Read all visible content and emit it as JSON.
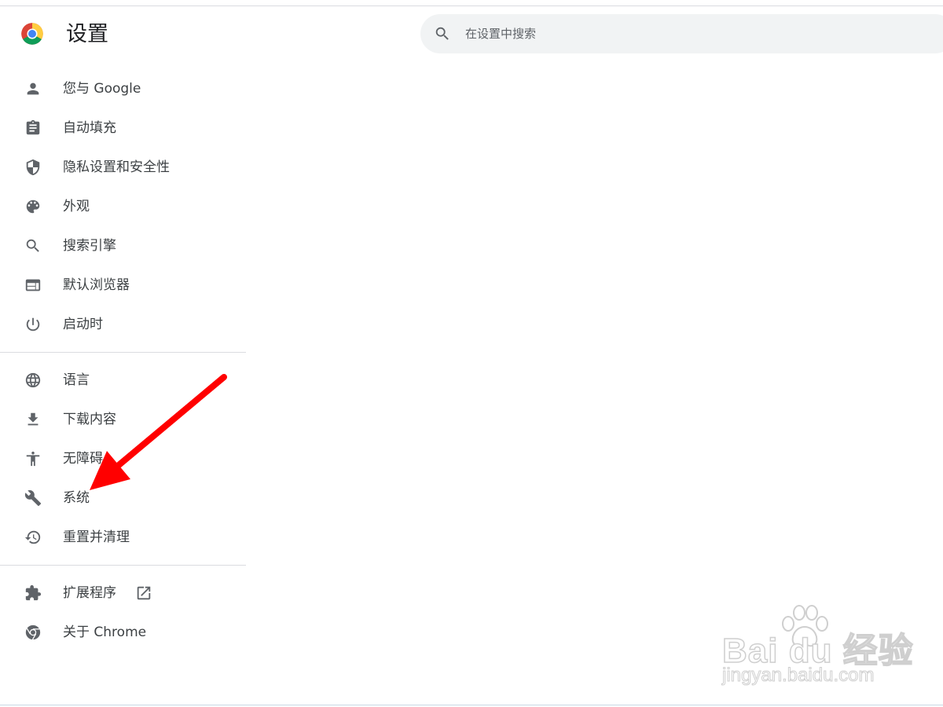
{
  "header": {
    "title": "设置",
    "search_placeholder": "在设置中搜索"
  },
  "nav": {
    "group1": [
      {
        "label": "您与 Google",
        "icon": "person-icon"
      },
      {
        "label": "自动填充",
        "icon": "clipboard-icon"
      },
      {
        "label": "隐私设置和安全性",
        "icon": "shield-icon"
      },
      {
        "label": "外观",
        "icon": "palette-icon"
      },
      {
        "label": "搜索引擎",
        "icon": "search-icon"
      },
      {
        "label": "默认浏览器",
        "icon": "browser-window-icon"
      },
      {
        "label": "启动时",
        "icon": "power-icon"
      }
    ],
    "group2": [
      {
        "label": "语言",
        "icon": "globe-icon"
      },
      {
        "label": "下载内容",
        "icon": "download-icon"
      },
      {
        "label": "无障碍",
        "icon": "accessibility-icon"
      },
      {
        "label": "系统",
        "icon": "wrench-icon"
      },
      {
        "label": "重置并清理",
        "icon": "history-icon"
      }
    ],
    "group3": [
      {
        "label": "扩展程序",
        "icon": "puzzle-icon",
        "external_icon": "open-in-new-icon"
      },
      {
        "label": "关于 Chrome",
        "icon": "chrome-icon"
      }
    ]
  },
  "annotation": {
    "arrow_color": "#ff0000",
    "target": "系统"
  },
  "watermark": {
    "brand": "Bai du 经验",
    "url": "jingyan.baidu.com"
  },
  "colors": {
    "icon": "#5f6368",
    "text": "#3c4043",
    "search_bg": "#f1f3f4",
    "divider": "#dadce0"
  }
}
